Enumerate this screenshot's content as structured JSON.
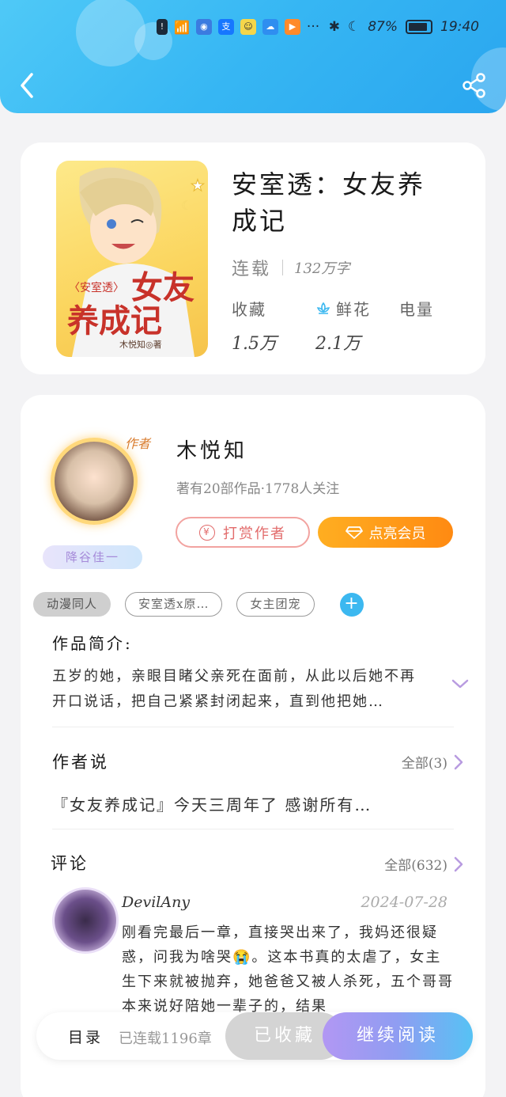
{
  "status_bar": {
    "battery": "87%",
    "time": "19:40",
    "more": "···",
    "battery_level": 0.87
  },
  "book": {
    "title": "安室透：女友养成记",
    "cover_series": "〈安室透〉",
    "cover_title_1": "女友",
    "cover_title_2": "养成记",
    "cover_author": "木悦知◎著",
    "status": "连载",
    "word_count": "132万字",
    "stats": [
      {
        "label": "收藏",
        "value": "1.5万"
      },
      {
        "label": "鲜花",
        "value": "2.1万"
      },
      {
        "label": "电量",
        "value": ""
      }
    ]
  },
  "author": {
    "badge": "作者",
    "name": "木悦知",
    "desc": "著有20部作品·1778人关注",
    "fan_badge": "降谷佳一",
    "tip_label": "打赏作者",
    "tip_icon": "¥",
    "vip_label": "点亮会员"
  },
  "tags": [
    "动漫同人",
    "安室透x原…",
    "女主团宠"
  ],
  "intro": {
    "title": "作品简介:",
    "text": "五岁的她，亲眼目睹父亲死在面前，从此以后她不再开口说话，把自己紧紧封闭起来，直到他把她…"
  },
  "author_says": {
    "title": "作者说",
    "all": "全部(3)",
    "text": "『女友养成记』今天三周年了 感谢所有…"
  },
  "comments": {
    "title": "评论",
    "all": "全部(632)",
    "items": [
      {
        "user": "DevilAny",
        "date": "2024-07-28",
        "text": "刚看完最后一章，直接哭出来了，我妈还很疑惑，问我为啥哭😭。这本书真的太虐了，女主生下来就被抛弃，她爸爸又被人杀死，五个哥哥本来说好陪她一辈子的，结果"
      }
    ]
  },
  "bottom_bar": {
    "toc_label": "目录",
    "toc_count": "已连载1196章",
    "collected_label": "已收藏",
    "read_label": "继续阅读"
  },
  "colors": {
    "header": "#36b6f3",
    "vip": "#ff9a18",
    "tip": "#e26b6b",
    "accent_purple": "#a58ad9"
  }
}
